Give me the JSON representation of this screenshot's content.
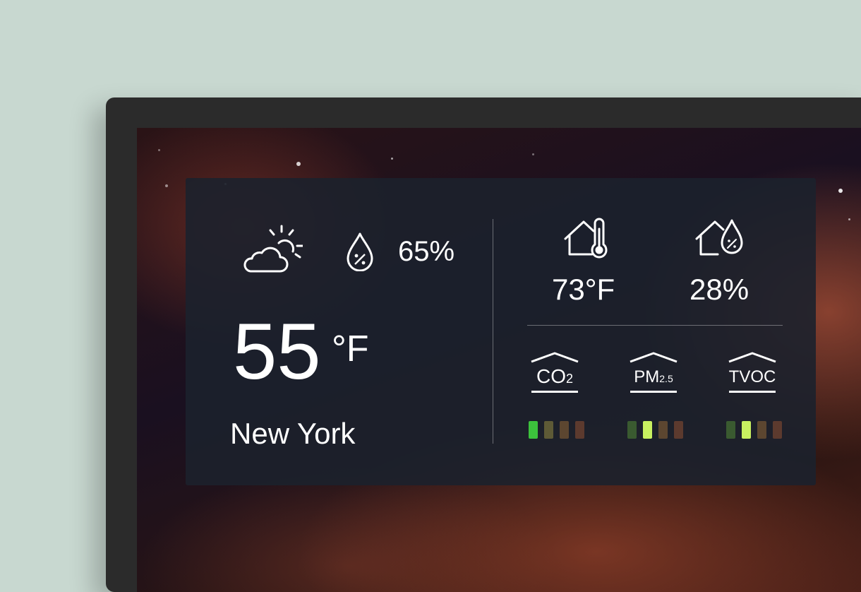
{
  "weather": {
    "outdoor_humidity": "65%",
    "temperature_value": "55",
    "temperature_unit": "°F",
    "city": "New York"
  },
  "indoor": {
    "temperature": "73°F",
    "humidity": "28%"
  },
  "air_quality": [
    {
      "label": "CO",
      "subscript": "2",
      "level": 1
    },
    {
      "label": "PM",
      "subscript": "2.5",
      "level": 2
    },
    {
      "label": "TVOC",
      "subscript": "",
      "level": 2
    }
  ],
  "colors": {
    "bar_active_good": "#3cc23c",
    "bar_active_moderate": "#c8f060",
    "bar_inactive_1": "#3a5a30",
    "bar_inactive_2": "#5e5a36",
    "bar_inactive_3": "#5c4630",
    "bar_inactive_4": "#5c3a2e"
  },
  "icons": [
    "cloud-sun-icon",
    "humidity-drop-icon",
    "house-thermometer-icon",
    "house-humidity-icon"
  ]
}
